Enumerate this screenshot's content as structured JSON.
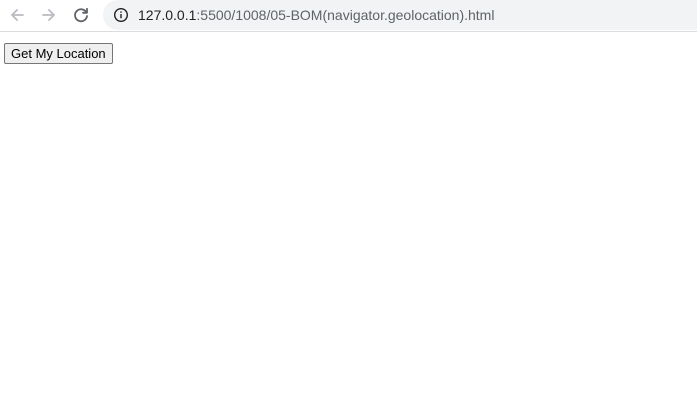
{
  "browser": {
    "nav": {
      "back_icon": "arrow-left-icon",
      "forward_icon": "arrow-right-icon",
      "reload_icon": "reload-icon"
    },
    "address_bar": {
      "info_icon": "info-icon",
      "host": "127.0.0.1",
      "path": ":5500/1008/05-BOM(navigator.geolocation).html"
    }
  },
  "page": {
    "button_label": "Get My Location"
  },
  "colors": {
    "toolbar_bg": "#ffffff",
    "address_bg": "#f1f3f4",
    "icon_disabled": "#b8bcc1",
    "icon_active": "#5f6368",
    "url_host": "#202124",
    "url_path": "#5f6368"
  }
}
